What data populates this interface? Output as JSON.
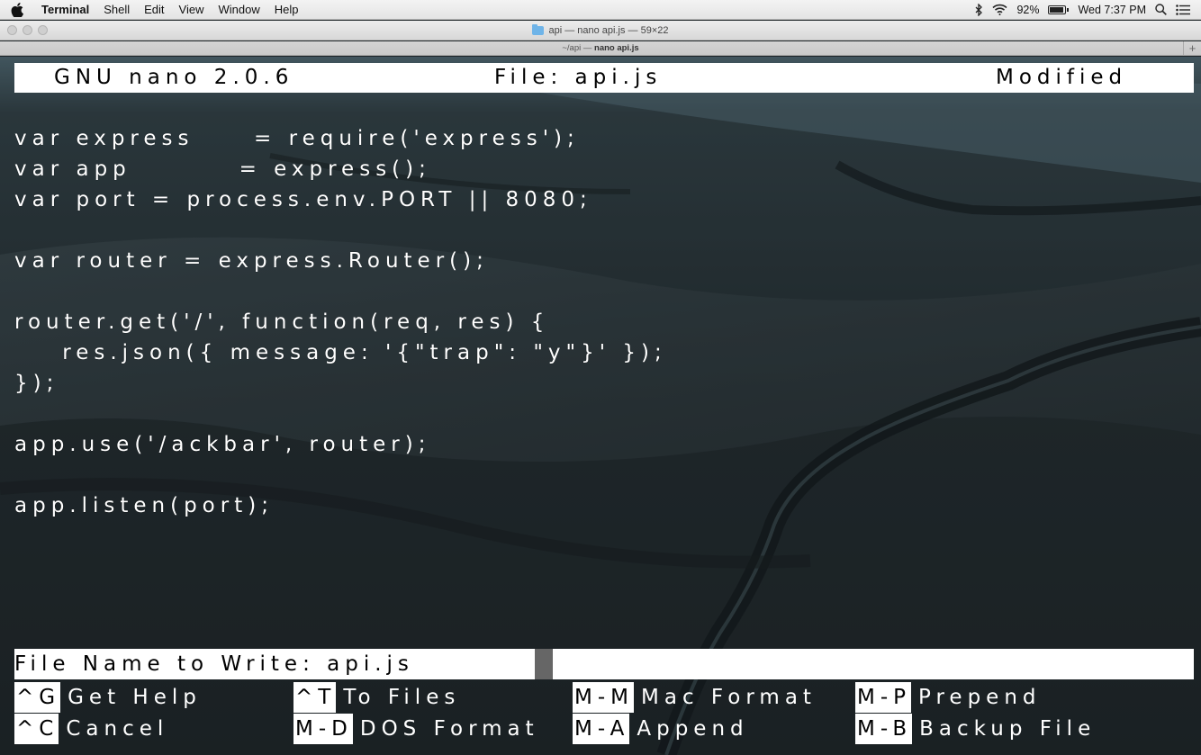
{
  "menubar": {
    "app_name": "Terminal",
    "items": [
      "Shell",
      "Edit",
      "View",
      "Window",
      "Help"
    ],
    "battery": "92%",
    "clock": "Wed 7:37 PM",
    "battery_level": 0.92
  },
  "window": {
    "title": "api — nano api.js — 59×22",
    "tab_path": "~/api — ",
    "tab_name": "nano api.js",
    "new_tab": "+"
  },
  "nano": {
    "header": {
      "version": "GNU nano 2.0.6",
      "file": "File: api.js",
      "status": "Modified"
    },
    "code_lines": [
      "var express     = require('express');",
      "var app         = express();",
      "var port = process.env.PORT || 8080;",
      "",
      "var router = express.Router();",
      "",
      "router.get('/', function(req, res) {",
      "    res.json({ message: '{\"trap\": \"y\"}' });",
      "});",
      "",
      "app.use('/ackbar', router);",
      "",
      "app.listen(port);"
    ],
    "prompt": "File Name to Write: api.js",
    "shortcuts_row1": [
      {
        "key": "^G",
        "label": "Get Help"
      },
      {
        "key": "^T",
        "label": "To Files"
      },
      {
        "key": "M-M",
        "label": "Mac Format"
      },
      {
        "key": "M-P",
        "label": "Prepend"
      }
    ],
    "shortcuts_row2": [
      {
        "key": "^C",
        "label": "Cancel"
      },
      {
        "key": "M-D",
        "label": "DOS Format"
      },
      {
        "key": "M-A",
        "label": "Append"
      },
      {
        "key": "M-B",
        "label": "Backup File"
      }
    ]
  }
}
